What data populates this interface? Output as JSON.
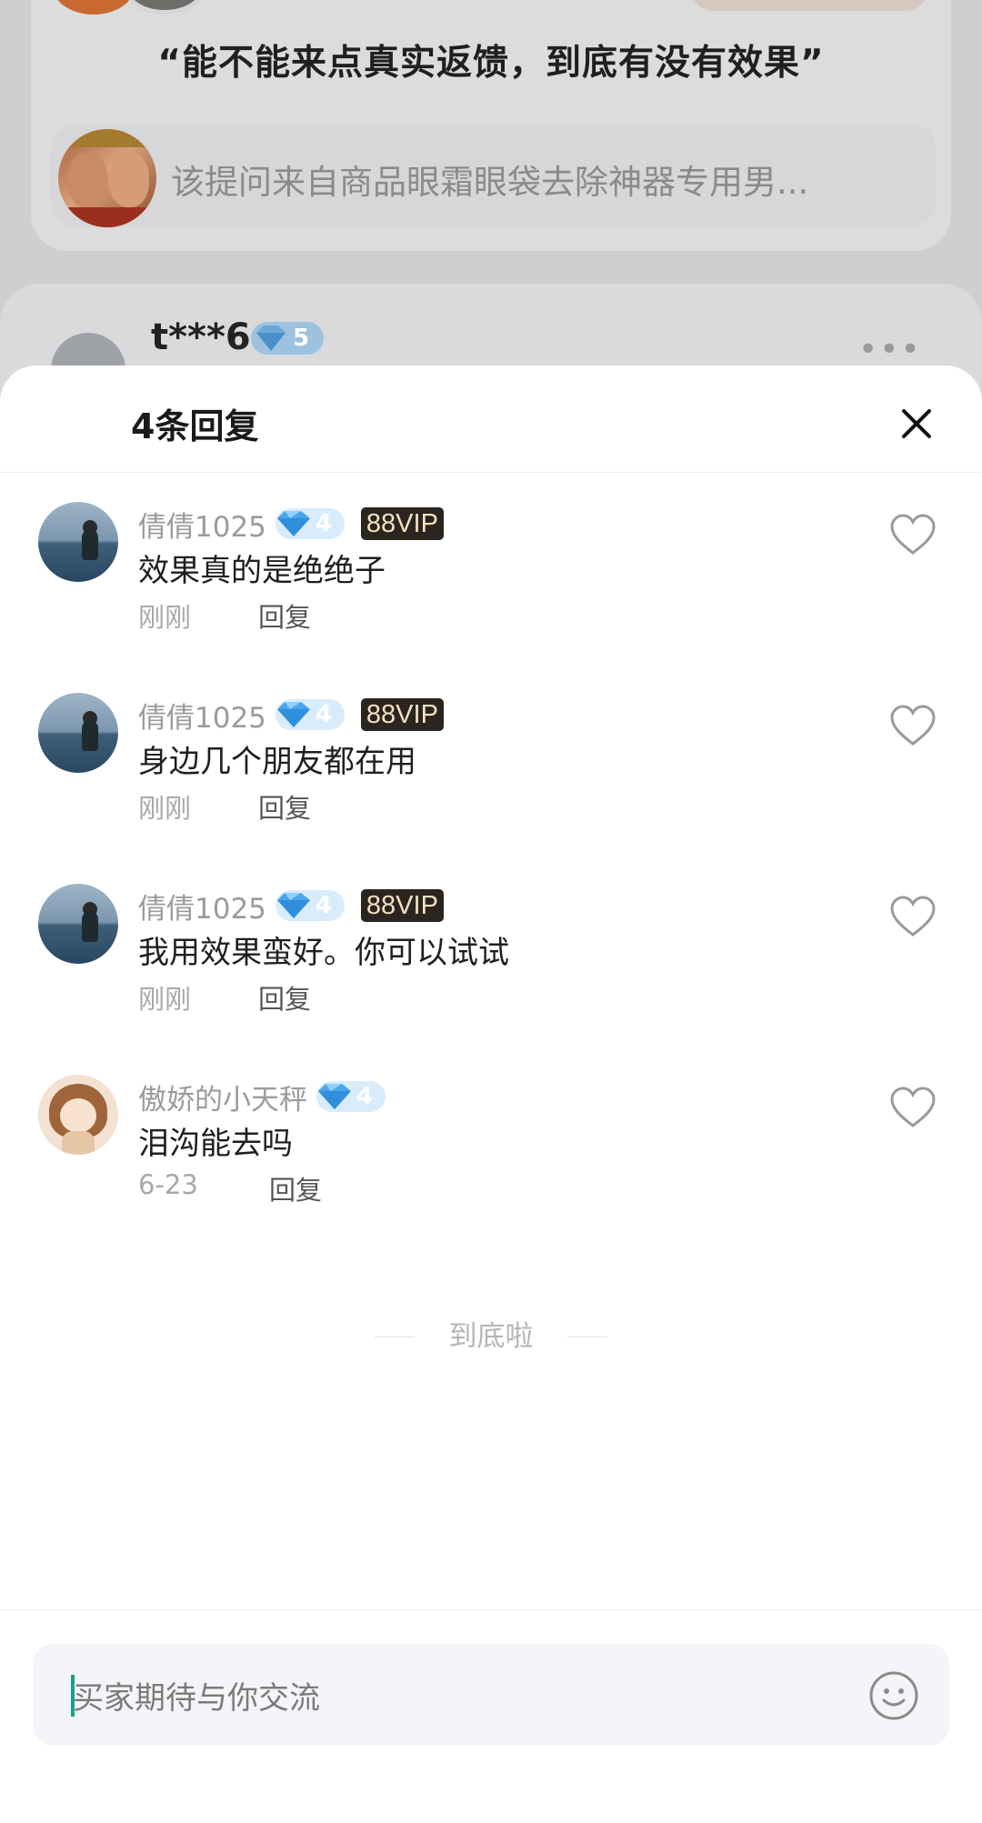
{
  "background": {
    "question": "“能不能来点真实返馈，到底有没有效果”",
    "product_source": "该提问来自商品眼霜眼袋去除神器专用男...",
    "user": {
      "name": "t***6",
      "level": "5"
    }
  },
  "sheet": {
    "title": "4条回复",
    "replies": [
      {
        "user": "倩倩1025",
        "level": "4",
        "vip": "88VIP",
        "text": "效果真的是绝绝子",
        "time": "刚刚",
        "reply_label": "回复"
      },
      {
        "user": "倩倩1025",
        "level": "4",
        "vip": "88VIP",
        "text": "身边几个朋友都在用",
        "time": "刚刚",
        "reply_label": "回复"
      },
      {
        "user": "倩倩1025",
        "level": "4",
        "vip": "88VIP",
        "text": "我用效果蛮好。你可以试试",
        "time": "刚刚",
        "reply_label": "回复"
      },
      {
        "user": "傲娇的小天秤",
        "level": "4",
        "text": "泪沟能去吗",
        "time": "6-23",
        "reply_label": "回复"
      }
    ],
    "end_text": "到底啦",
    "input_placeholder": "买家期待与你交流"
  },
  "colors": {
    "accent": "#12a38a",
    "level_badge": "#d8ecfb",
    "vip_bg": "#2a2520"
  }
}
